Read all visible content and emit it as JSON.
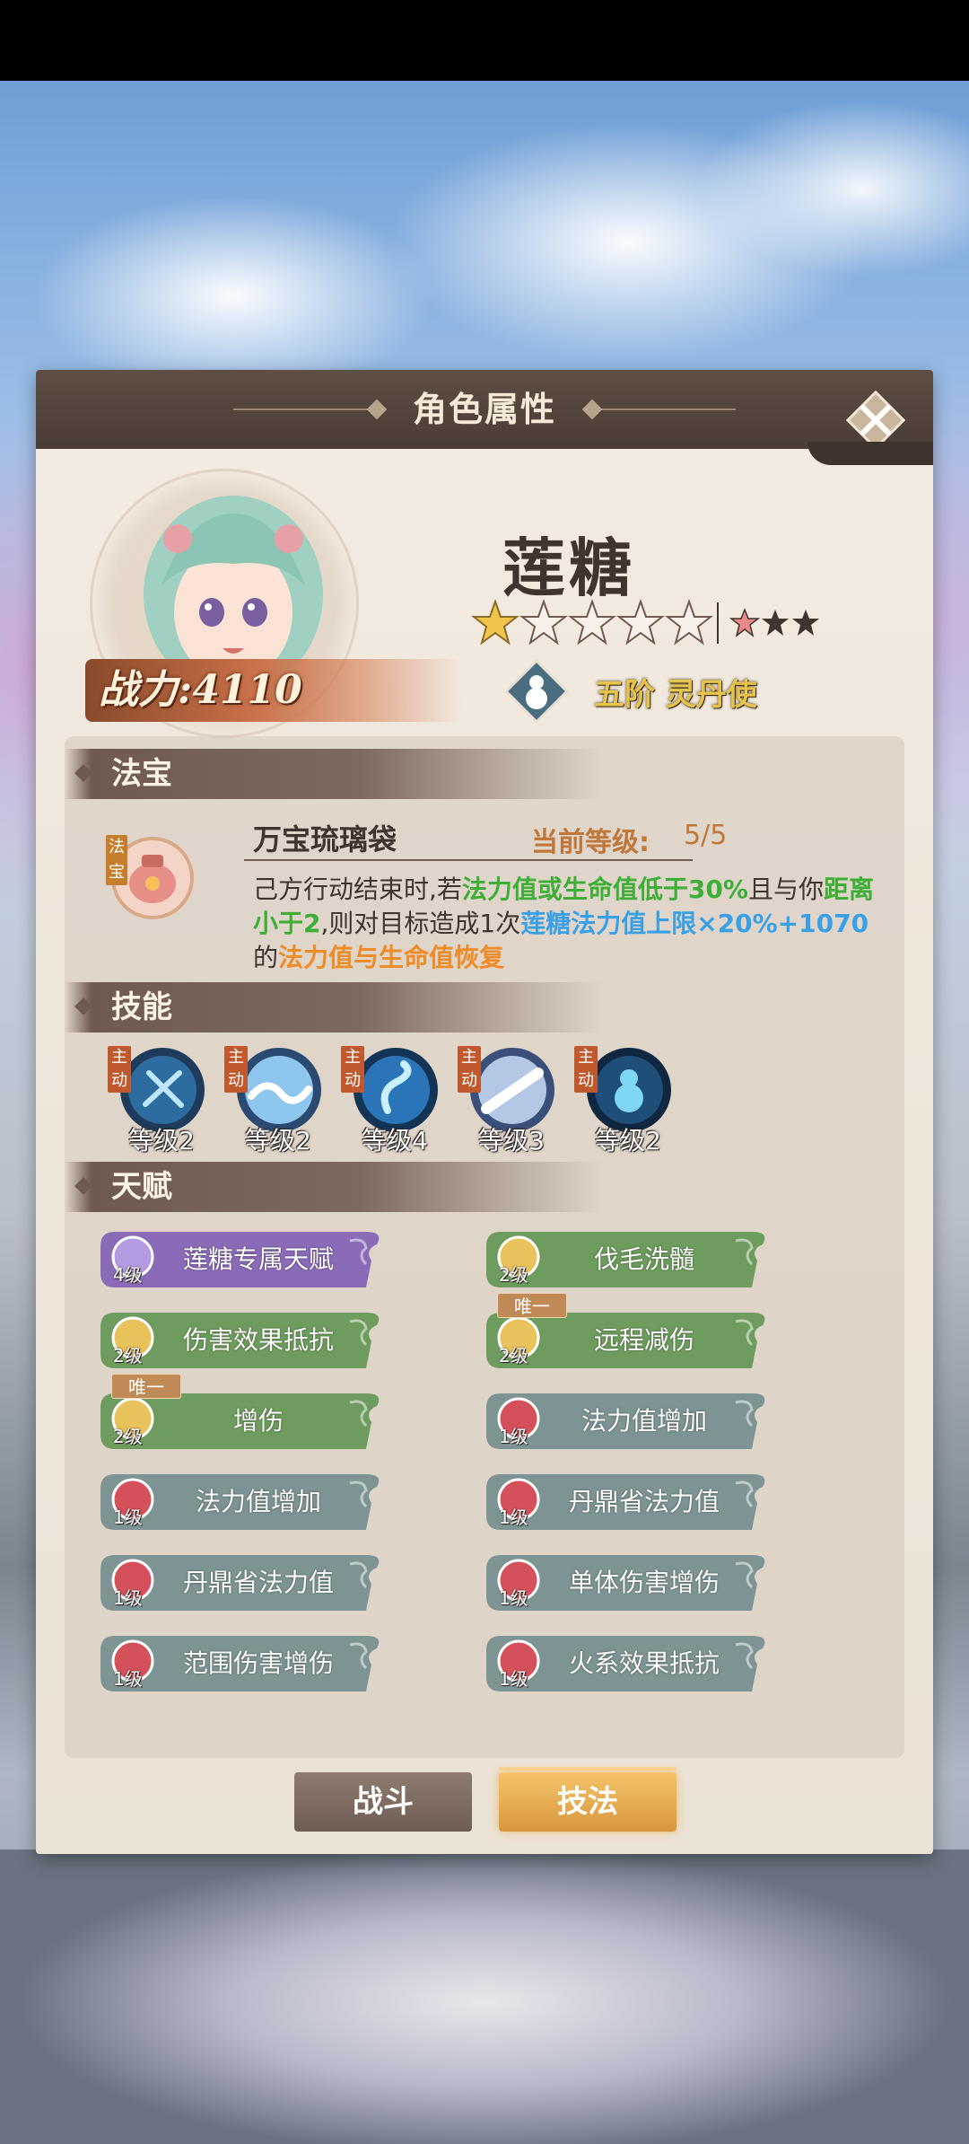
{
  "panel": {
    "title": "角色属性"
  },
  "character": {
    "name": "莲糖",
    "power": "战力:4110",
    "stars_filled": 1,
    "stars_total": 5,
    "sub_stars": 3,
    "rank": "五阶 灵丹使"
  },
  "treasure": {
    "section_title": "法宝",
    "tag": "法宝",
    "name": "万宝琉璃袋",
    "level_label": "当前等级:",
    "level_value": "5/5",
    "desc": {
      "p1": "己方行动结束时,若",
      "p2": "法力值或生命值低于30%",
      "p3": "且与你",
      "p4": "距离小于2",
      "p5": ",则对目标造成1次",
      "p6": "莲糖法力值上限×20%+1070",
      "p7": "的",
      "p8": "法力值与生命值恢复"
    }
  },
  "skills": {
    "section_title": "技能",
    "tag": "主动",
    "items": [
      {
        "level": "等级2"
      },
      {
        "level": "等级2"
      },
      {
        "level": "等级4"
      },
      {
        "level": "等级3"
      },
      {
        "level": "等级2"
      }
    ]
  },
  "talents": {
    "section_title": "天赋",
    "unique_label": "唯一",
    "items": [
      {
        "name": "莲糖专属天赋",
        "level": "4级",
        "color": "#8a6bb8"
      },
      {
        "name": "伐毛洗髓",
        "level": "2级",
        "color": "#6e9c5e"
      },
      {
        "name": "伤害效果抵抗",
        "level": "2级",
        "color": "#6e9c5e"
      },
      {
        "name": "远程减伤",
        "level": "2级",
        "color": "#6e9c5e"
      },
      {
        "name": "增伤",
        "level": "2级",
        "color": "#6e9c5e"
      },
      {
        "name": "法力值增加",
        "level": "1级",
        "color": "#7e9494"
      },
      {
        "name": "法力值增加",
        "level": "1级",
        "color": "#7e9494"
      },
      {
        "name": "丹鼎省法力值",
        "level": "1级",
        "color": "#7e9494"
      },
      {
        "name": "丹鼎省法力值",
        "level": "1级",
        "color": "#7e9494"
      },
      {
        "name": "单体伤害增伤",
        "level": "1级",
        "color": "#7e9494"
      },
      {
        "name": "范围伤害增伤",
        "level": "1级",
        "color": "#7e9494"
      },
      {
        "name": "火系效果抵抗",
        "level": "1级",
        "color": "#7e9494"
      }
    ]
  },
  "tabs": {
    "battle": "战斗",
    "skill": "技法"
  },
  "colors": {
    "accent_gold": "#e6c34a",
    "highlight_green": "#3fae36",
    "highlight_blue": "#3aa0e6",
    "highlight_orange": "#ee8c28"
  }
}
